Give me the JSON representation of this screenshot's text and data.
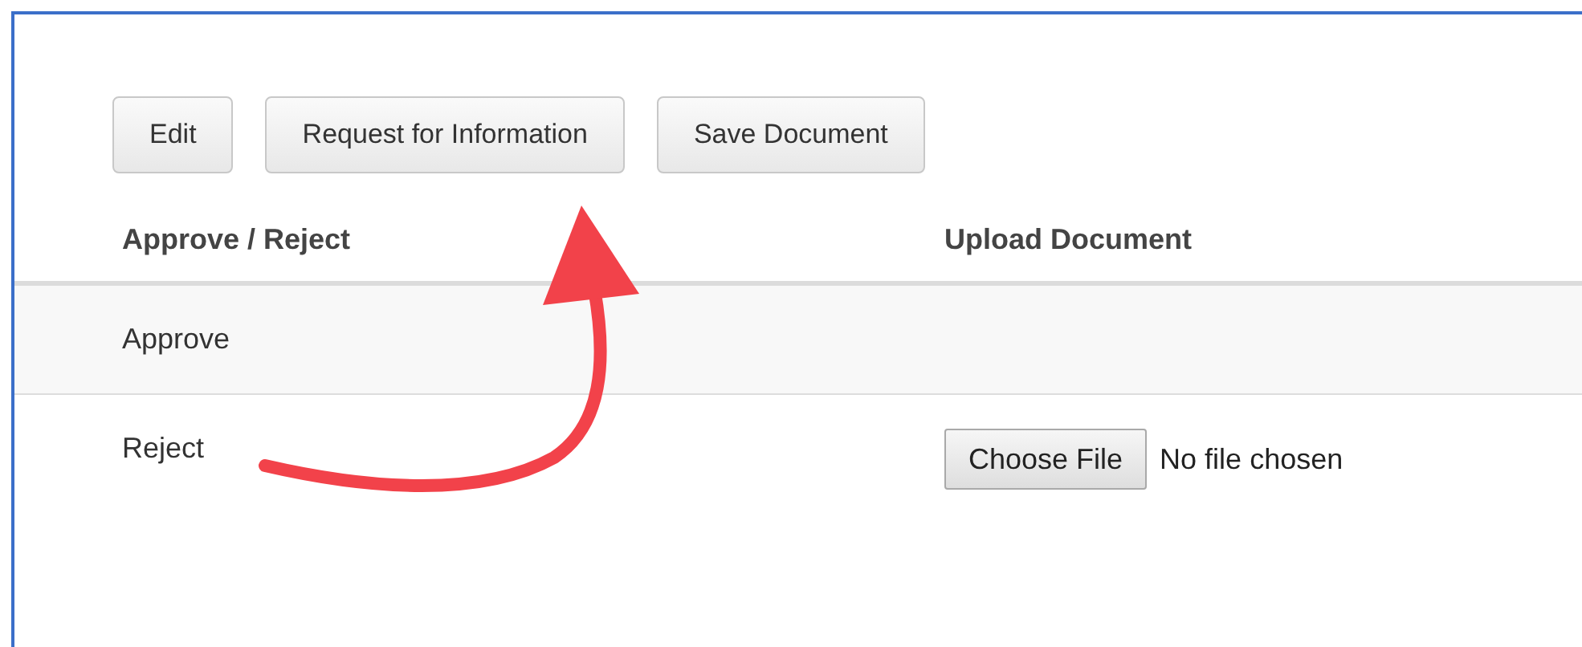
{
  "toolbar": {
    "buttons": [
      "Edit",
      "Request for Information",
      "Save Document"
    ]
  },
  "table": {
    "columns": [
      "Approve / Reject",
      "Upload Document"
    ],
    "rows": [
      {
        "label": "Approve"
      },
      {
        "label": "Reject",
        "upload": {
          "button": "Choose File",
          "status": "No file chosen"
        }
      }
    ]
  }
}
